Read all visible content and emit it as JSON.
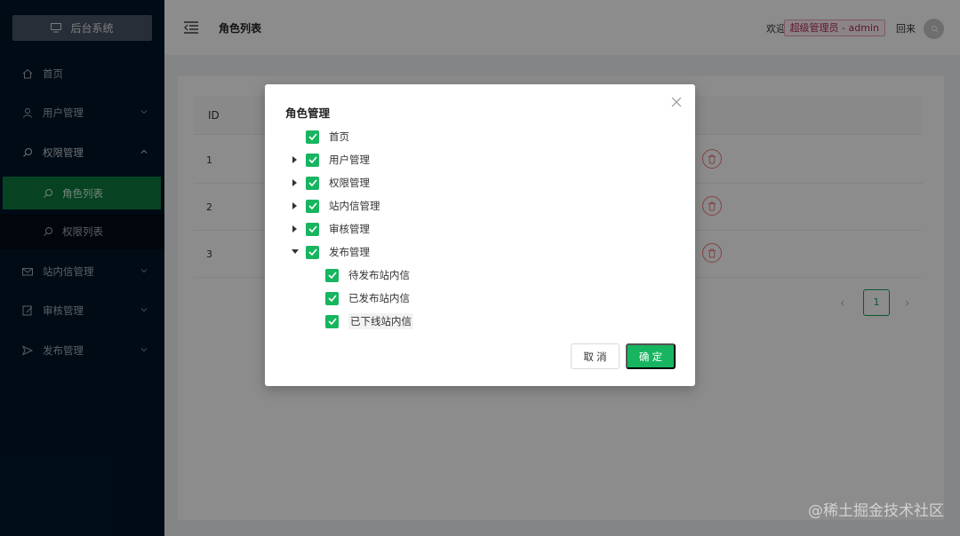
{
  "sidebar": {
    "logo_text": "后台系统",
    "items": [
      {
        "label": "首页",
        "icon": "home-icon"
      },
      {
        "label": "用户管理",
        "icon": "user-icon"
      },
      {
        "label": "权限管理",
        "icon": "search-icon"
      },
      {
        "label": "站内信管理",
        "icon": "mail-icon"
      },
      {
        "label": "审核管理",
        "icon": "edit-icon"
      },
      {
        "label": "发布管理",
        "icon": "send-icon"
      }
    ],
    "sub_items": [
      {
        "label": "角色列表",
        "active": true
      },
      {
        "label": "权限列表",
        "active": false
      }
    ]
  },
  "header": {
    "title": "角色列表",
    "welcome": "欢迎",
    "user": "超级管理员 - admin",
    "exit": "回来"
  },
  "table": {
    "id_header": "ID",
    "rows": [
      "1",
      "2",
      "3"
    ]
  },
  "pager": {
    "current": "1"
  },
  "modal": {
    "title": "角色管理",
    "tree": [
      {
        "label": "首页",
        "level": 0,
        "arrow": "none",
        "checked": true
      },
      {
        "label": "用户管理",
        "level": 0,
        "arrow": "collapsed",
        "checked": true
      },
      {
        "label": "权限管理",
        "level": 0,
        "arrow": "collapsed",
        "checked": true
      },
      {
        "label": "站内信管理",
        "level": 0,
        "arrow": "collapsed",
        "checked": true
      },
      {
        "label": "审核管理",
        "level": 0,
        "arrow": "collapsed",
        "checked": true
      },
      {
        "label": "发布管理",
        "level": 0,
        "arrow": "expanded",
        "checked": true
      },
      {
        "label": "待发布站内信",
        "level": 1,
        "arrow": "none",
        "checked": true
      },
      {
        "label": "已发布站内信",
        "level": 1,
        "arrow": "none",
        "checked": true
      },
      {
        "label": "已下线站内信",
        "level": 1,
        "arrow": "none",
        "checked": true
      }
    ],
    "cancel": "取 消",
    "ok": "确 定"
  },
  "watermark": "@稀土掘金技术社区",
  "colors": {
    "accent": "#17b560",
    "sidebar_bg": "#001529",
    "danger": "#f07a7a"
  }
}
